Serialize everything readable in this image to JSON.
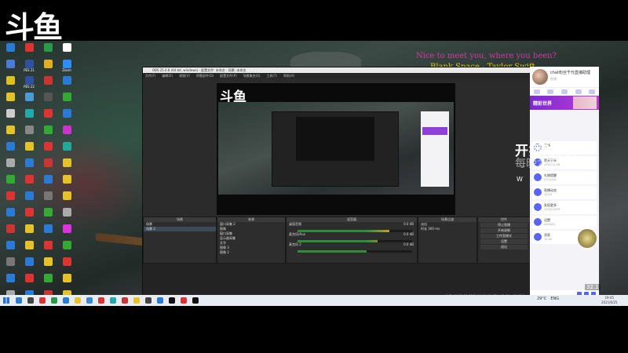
{
  "logo_text": "斗鱼",
  "music": {
    "line1": "Nice to meet you, where you been?",
    "line2": "Blank Space - Taylor Swift"
  },
  "desktop_icons": [
    {
      "label": "",
      "color": "#2a7ad6"
    },
    {
      "label": "",
      "color": "#d33"
    },
    {
      "label": "",
      "color": "#2a9a4a"
    },
    {
      "label": "",
      "color": "#fff"
    },
    {
      "label": "",
      "color": "#4a7ad6"
    },
    {
      "label": "PES 21",
      "color": "#3050a0"
    },
    {
      "label": "",
      "color": "#e0b020"
    },
    {
      "label": "Zoom",
      "color": "#2d8cff"
    },
    {
      "label": "",
      "color": "#e0c020"
    },
    {
      "label": "PES 22",
      "color": "#3050a0"
    },
    {
      "label": "",
      "color": "#c33"
    },
    {
      "label": "",
      "color": "#2a7ad6"
    },
    {
      "label": "",
      "color": "#e6c229"
    },
    {
      "label": "",
      "color": "#4a9ad6"
    },
    {
      "label": "",
      "color": "#555"
    },
    {
      "label": "",
      "color": "#3a3"
    },
    {
      "label": "",
      "color": "#ccc"
    },
    {
      "label": "",
      "color": "#2aa"
    },
    {
      "label": "",
      "color": "#d33"
    },
    {
      "label": "",
      "color": "#2a7ad6"
    },
    {
      "label": "",
      "color": "#e6c229"
    },
    {
      "label": "",
      "color": "#888"
    },
    {
      "label": "",
      "color": "#3a3"
    },
    {
      "label": "",
      "color": "#c3c"
    },
    {
      "label": "",
      "color": "#2a7ad6"
    },
    {
      "label": "",
      "color": "#e6c229"
    },
    {
      "label": "",
      "color": "#d33"
    },
    {
      "label": "",
      "color": "#2a9"
    },
    {
      "label": "",
      "color": "#aaa"
    },
    {
      "label": "",
      "color": "#2a7ad6"
    },
    {
      "label": "",
      "color": "#c33"
    },
    {
      "label": "",
      "color": "#e6c229"
    },
    {
      "label": "",
      "color": "#3a3"
    },
    {
      "label": "",
      "color": "#d33"
    },
    {
      "label": "",
      "color": "#2a7ad6"
    },
    {
      "label": "",
      "color": "#e6c229"
    },
    {
      "label": "",
      "color": "#d33"
    },
    {
      "label": "",
      "color": "#2a7ad6"
    },
    {
      "label": "",
      "color": "#777"
    },
    {
      "label": "",
      "color": "#e6c229"
    },
    {
      "label": "",
      "color": "#2a7ad6"
    },
    {
      "label": "",
      "color": "#d33"
    },
    {
      "label": "",
      "color": "#3a3"
    },
    {
      "label": "",
      "color": "#aaa"
    },
    {
      "label": "",
      "color": "#c33"
    },
    {
      "label": "",
      "color": "#e6c229"
    },
    {
      "label": "",
      "color": "#2a7ad6"
    },
    {
      "label": "",
      "color": "#d3d"
    },
    {
      "label": "",
      "color": "#2a7ad6"
    },
    {
      "label": "",
      "color": "#e6c229"
    },
    {
      "label": "",
      "color": "#d33"
    },
    {
      "label": "",
      "color": "#3a3"
    },
    {
      "label": "",
      "color": "#777"
    },
    {
      "label": "",
      "color": "#2a7ad6"
    },
    {
      "label": "",
      "color": "#e6c229"
    },
    {
      "label": "",
      "color": "#d33"
    },
    {
      "label": "",
      "color": "#2a7ad6"
    },
    {
      "label": "",
      "color": "#d33"
    },
    {
      "label": "",
      "color": "#3a3"
    },
    {
      "label": "",
      "color": "#e6c229"
    },
    {
      "label": "",
      "color": "#aaa"
    },
    {
      "label": "",
      "color": "#2a7ad6"
    },
    {
      "label": "",
      "color": "#c33"
    },
    {
      "label": "",
      "color": "#e6c229"
    }
  ],
  "obs": {
    "title": "OBS 25.0.8 (64 bit, windows) - 配置文件: 未命名 - 场景: 未命名",
    "menu": [
      "文件(F)",
      "编辑(E)",
      "视图(V)",
      "停靠部件(D)",
      "配置文件(P)",
      "场景集合(S)",
      "工具(T)",
      "帮助(H)"
    ],
    "preview_logo": "斗鱼",
    "scenes_header": "场景",
    "scenes": [
      "场景",
      "场景 2"
    ],
    "sources_header": "来源",
    "sources": [
      "窗口采集 2",
      "图像",
      "窗口采集",
      "显示器采集",
      "文字",
      "图像 3",
      "图像 2"
    ],
    "mixer_header": "混音器",
    "mixer": [
      {
        "name": "桌面音频",
        "db": "0.0 dB"
      },
      {
        "name": "麦克风/Aux",
        "db": "0.0 dB"
      },
      {
        "name": "麦克风 2",
        "db": "0.0 dB"
      }
    ],
    "transitions_header": "场景过渡",
    "transition": "淡出",
    "duration_label": "时长",
    "duration": "300 ms",
    "controls_header": "控件",
    "controls": [
      "停止直播",
      "开始录制",
      "工作室模式",
      "设置",
      "退出"
    ],
    "status": "LIVE: 00:58:21   REC: 00:00:00   CPU: 11.5%, 60.00 fps"
  },
  "chat": {
    "name": "chat粉丝千代直播助理",
    "sub": "在线",
    "banner": "精彩世界",
    "overlay_title": "开播时间:",
    "overlay_sub": "每晚六点半",
    "overlay_w": "W",
    "items": [
      {
        "t": "表情",
        "s": ""
      },
      {
        "t": "聊天记录",
        "s": "2020/11/08"
      },
      {
        "t": "礼物提醒",
        "s": "27/12/20"
      },
      {
        "t": "直播动态",
        "s": "12:15"
      },
      {
        "t": "发现更多",
        "s": "2020/12/03"
      },
      {
        "t": "设置",
        "s": "2020/01"
      },
      {
        "t": "消息",
        "s": "10:00"
      }
    ]
  },
  "badge": "32.1",
  "taskbar": {
    "icons": [
      "#2a7ad6",
      "#444",
      "#d33",
      "#2a9a4a",
      "#2a7ad6",
      "#e6c229",
      "#3a8ad6",
      "#d33",
      "#2aa",
      "#c33",
      "#e6c229",
      "#444",
      "#2a7ad6",
      "#111",
      "#d33",
      "#111"
    ],
    "weather": "29°C",
    "tray": "ENG",
    "time": "19:45",
    "date": "2021/6/25"
  }
}
